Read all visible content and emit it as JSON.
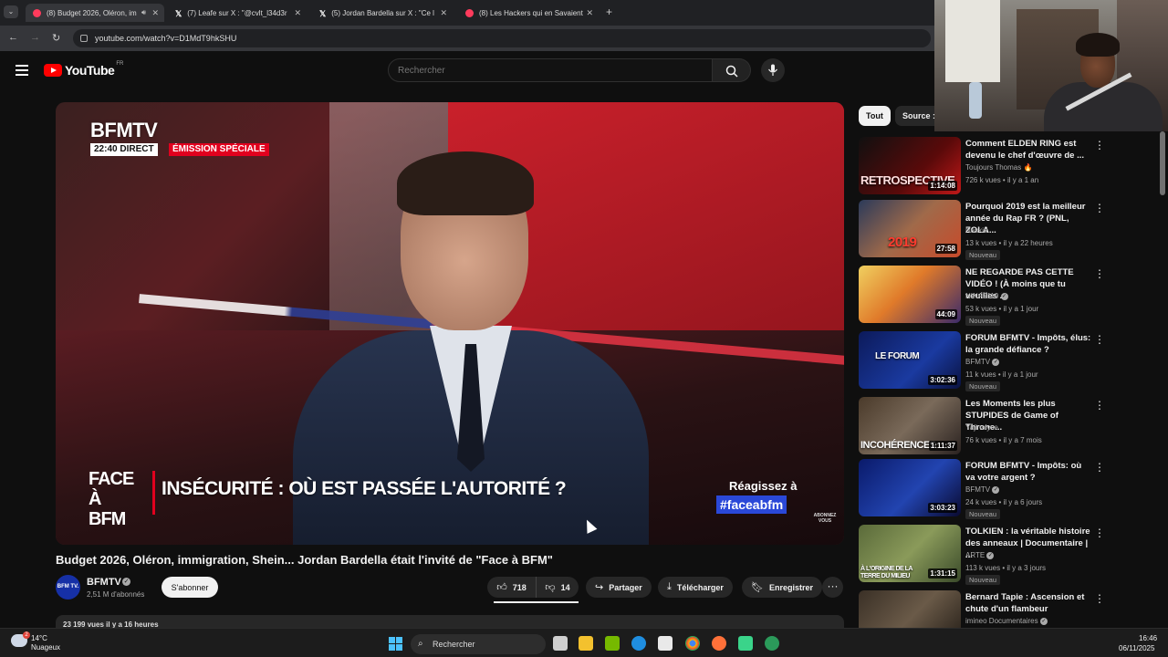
{
  "browser": {
    "tabs": [
      {
        "label": "(8) Budget 2026, Oléron, im",
        "icon": "youtube-icon"
      },
      {
        "label": "(7) Leafe sur X : \"@cvlt_l34d3r",
        "icon": "x-icon"
      },
      {
        "label": "(5) Jordan Bardella sur X : \"Ce l",
        "icon": "x-icon"
      },
      {
        "label": "(8) Les Hackers qui en Savaient",
        "icon": "youtube-icon"
      }
    ],
    "url": "youtube.com/watch?v=D1MdT9hkSHU"
  },
  "youtube": {
    "logo_text": "YouTube",
    "region": "FR",
    "search_placeholder": "Rechercher"
  },
  "player_overlay": {
    "brand": "BFMTV",
    "time": "22:40",
    "live": "DIRECT",
    "special": "ÉMISSION SPÉCIALE",
    "show_line1": "FACE À",
    "show_line2": "BFM",
    "headline": "INSÉCURITÉ : OÙ EST PASSÉE L'AUTORITÉ ?",
    "react": "Réagissez à",
    "hashtag": "#faceabfm",
    "small_line1": "ABONNEZ",
    "small_line2": "VOUS"
  },
  "video": {
    "title": "Budget 2026, Oléron, immigration, Shein... Jordan Bardella était l'invité de \"Face à BFM\"",
    "channel": "BFMTV",
    "avatar_text": "BFM TV.",
    "subscribers": "2,51 M d'abonnés",
    "subscribe_label": "S'abonner",
    "likes": "718",
    "dislikes": "14",
    "share_label": "Partager",
    "download_label": "Télécharger",
    "save_label": "Enregistrer",
    "description_peek": "23 199 vues  il y a 16 heures"
  },
  "chips": {
    "all": "Tout",
    "source": "Source :"
  },
  "recommendations": [
    {
      "title": "Comment ELDEN RING est devenu le chef d'œuvre de ...",
      "channel": "Toujours Thomas 🔥",
      "views": "726 k vues",
      "age": "il y a 1 an",
      "duration": "1:14:08",
      "thumb_text": "RETROSPECTIVE",
      "badge": ""
    },
    {
      "title": "Pourquoi 2019 est la meilleur année du Rap FR ? (PNL, ZOLA...",
      "channel": "Naskid",
      "views": "13 k vues",
      "age": "il y a 22 heures",
      "duration": "27:58",
      "thumb_text": "2019",
      "badge": "Nouveau"
    },
    {
      "title": "NE REGARDE PAS CETTE VIDÉO ! (À moins que tu veuilles ...",
      "channel": "NINA2119",
      "views": "53 k vues",
      "age": "il y a 1 jour",
      "duration": "44:09",
      "thumb_text": "",
      "badge": "Nouveau"
    },
    {
      "title": "FORUM BFMTV - Impôts, élus: la grande défiance ?",
      "channel": "BFMTV",
      "views": "11 k vues",
      "age": "il y a 1 jour",
      "duration": "3:02:36",
      "thumb_text": "LE FORUM",
      "badge": "Nouveau"
    },
    {
      "title": "Les Moments les plus STUPIDES de Game of Throne...",
      "channel": "Yajinalyse",
      "views": "76 k vues",
      "age": "il y a 7 mois",
      "duration": "1:11:37",
      "thumb_text": "INCOHÉRENCES",
      "badge": ""
    },
    {
      "title": "FORUM BFMTV - Impôts: où va votre argent ?",
      "channel": "BFMTV",
      "views": "24 k vues",
      "age": "il y a 6 jours",
      "duration": "3:03:23",
      "thumb_text": "",
      "badge": "Nouveau"
    },
    {
      "title": "TOLKIEN : la véritable histoire des anneaux | Documentaire | ...",
      "channel": "ARTE",
      "views": "113 k vues",
      "age": "il y a 3 jours",
      "duration": "1:31:15",
      "thumb_text": "À L'ORIGINE DE LA TERRE DU MILIEU",
      "badge": "Nouveau"
    },
    {
      "title": "Bernard Tapie : Ascension et chute d'un flambeur",
      "channel": "imineo Documentaires",
      "views": "",
      "age": "",
      "duration": "",
      "thumb_text": "",
      "badge": ""
    }
  ],
  "taskbar": {
    "temp": "14°C",
    "weather": "Nuageux",
    "weather_alert": "2",
    "search_label": "Rechercher",
    "time": "16:46",
    "date": "06/11/2025"
  }
}
